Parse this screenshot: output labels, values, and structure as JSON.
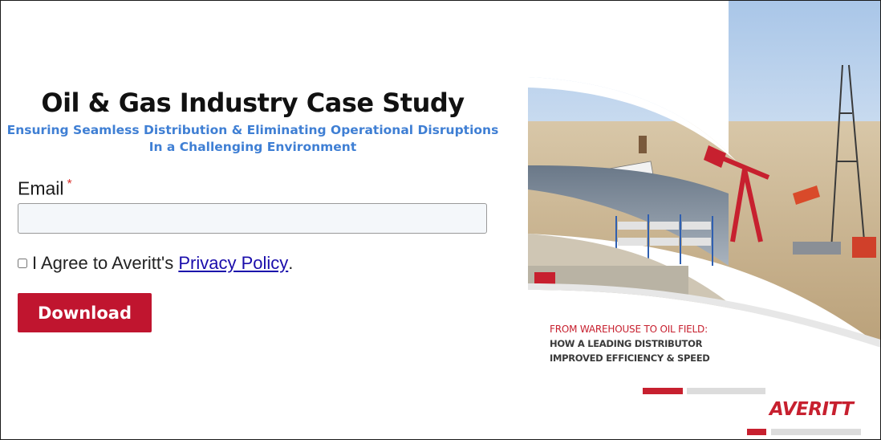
{
  "form": {
    "title": "Oil & Gas Industry Case Study",
    "subtitle_line1": "Ensuring Seamless Distribution & Eliminating Operational Disruptions",
    "subtitle_line2": "In a Challenging Environment",
    "email_label": "Email",
    "required_marker": "*",
    "email_value": "",
    "agree_prefix": "I Agree to Averitt's ",
    "privacy_link": "Privacy Policy",
    "agree_suffix": ".",
    "download_label": "Download"
  },
  "cover": {
    "line1": "FROM WAREHOUSE TO OIL FIELD:",
    "line2": "HOW A LEADING DISTRIBUTOR",
    "line3": "IMPROVED EFFICIENCY & SPEED",
    "logo_text": "AVERITT",
    "brand_red": "#c7202f",
    "accent_blue": "#3f7fd4"
  }
}
